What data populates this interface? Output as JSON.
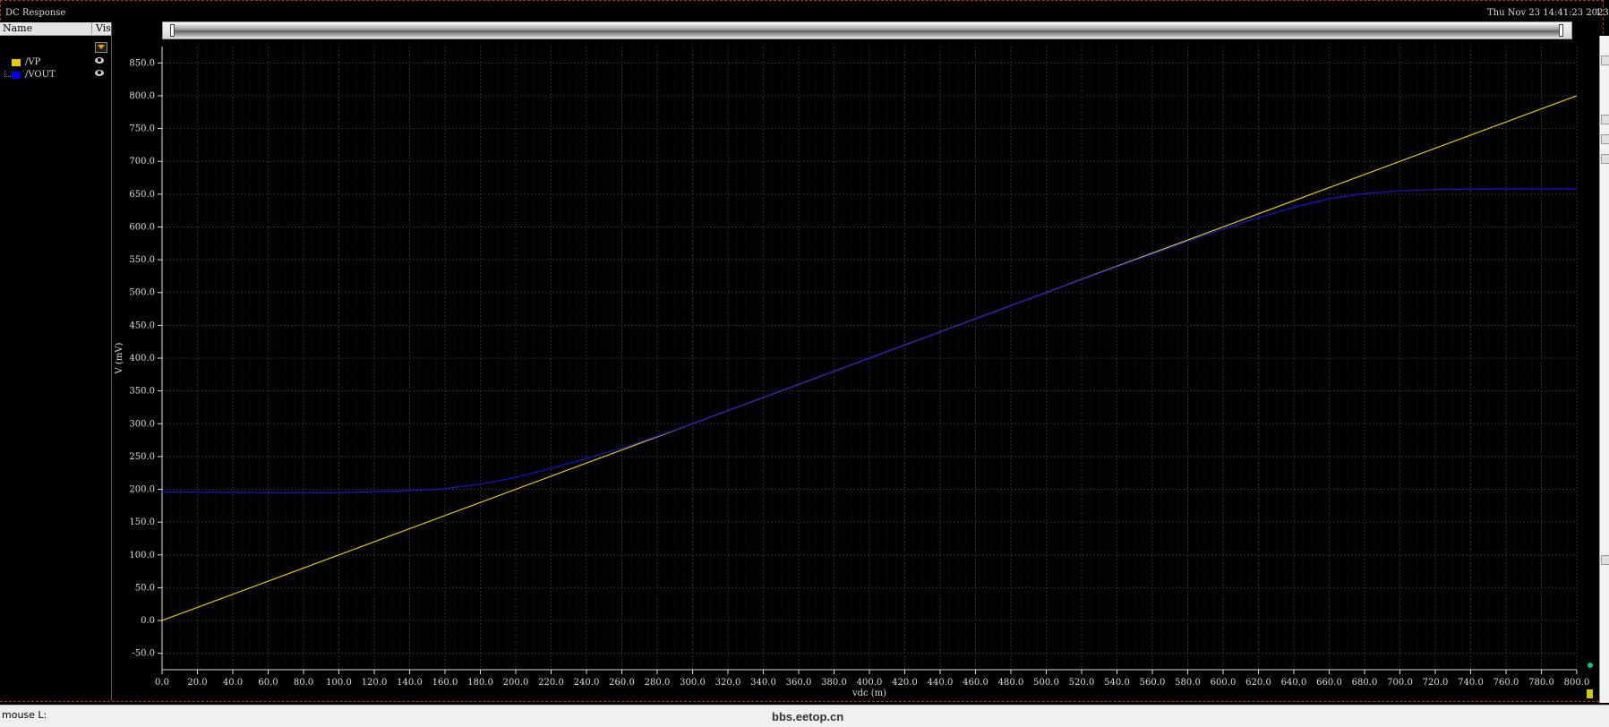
{
  "window": {
    "title": "DC Response",
    "datetime": "Thu Nov 23 14:41:23 2023",
    "datetime_suffix": "1"
  },
  "legend": {
    "header_name": "Name",
    "header_vis": "Vis",
    "items": [
      {
        "label": "/VP",
        "color": "#e6c800"
      },
      {
        "label": "/VOUT",
        "color": "#0000e6"
      }
    ]
  },
  "status": {
    "mouse_label": "mouse L:",
    "watermark": "bbs.eetop.cn"
  },
  "chart_data": {
    "type": "line",
    "xlabel": "vdc (m)",
    "ylabel": "V (mV)",
    "xlim": [
      0,
      800
    ],
    "ylim": [
      -75,
      875
    ],
    "x_ticks": [
      0,
      20,
      40,
      60,
      80,
      100,
      120,
      140,
      160,
      180,
      200,
      220,
      240,
      260,
      280,
      300,
      320,
      340,
      360,
      380,
      400,
      420,
      440,
      460,
      480,
      500,
      520,
      540,
      560,
      580,
      600,
      620,
      640,
      660,
      680,
      700,
      720,
      740,
      760,
      780,
      800
    ],
    "y_ticks": [
      -50,
      0,
      50,
      100,
      150,
      200,
      250,
      300,
      350,
      400,
      450,
      500,
      550,
      600,
      650,
      700,
      750,
      800,
      850
    ],
    "tick_decimals": 1,
    "grid": true,
    "background": "#000000",
    "series": [
      {
        "name": "/VP",
        "color": "#e6c800",
        "x": [
          0,
          800
        ],
        "y": [
          0,
          800
        ]
      },
      {
        "name": "/VOUT",
        "color": "#1414d8",
        "x": [
          0,
          60,
          100,
          140,
          160,
          180,
          200,
          220,
          240,
          260,
          280,
          300,
          350,
          400,
          450,
          500,
          550,
          580,
          600,
          620,
          640,
          660,
          680,
          700,
          720,
          760,
          800
        ],
        "y": [
          196,
          195,
          195,
          198,
          201,
          208,
          218,
          232,
          247,
          263,
          281,
          300,
          350,
          400,
          450,
          500,
          549,
          578,
          597,
          614,
          630,
          643,
          651,
          655,
          657,
          658,
          658
        ]
      }
    ]
  }
}
